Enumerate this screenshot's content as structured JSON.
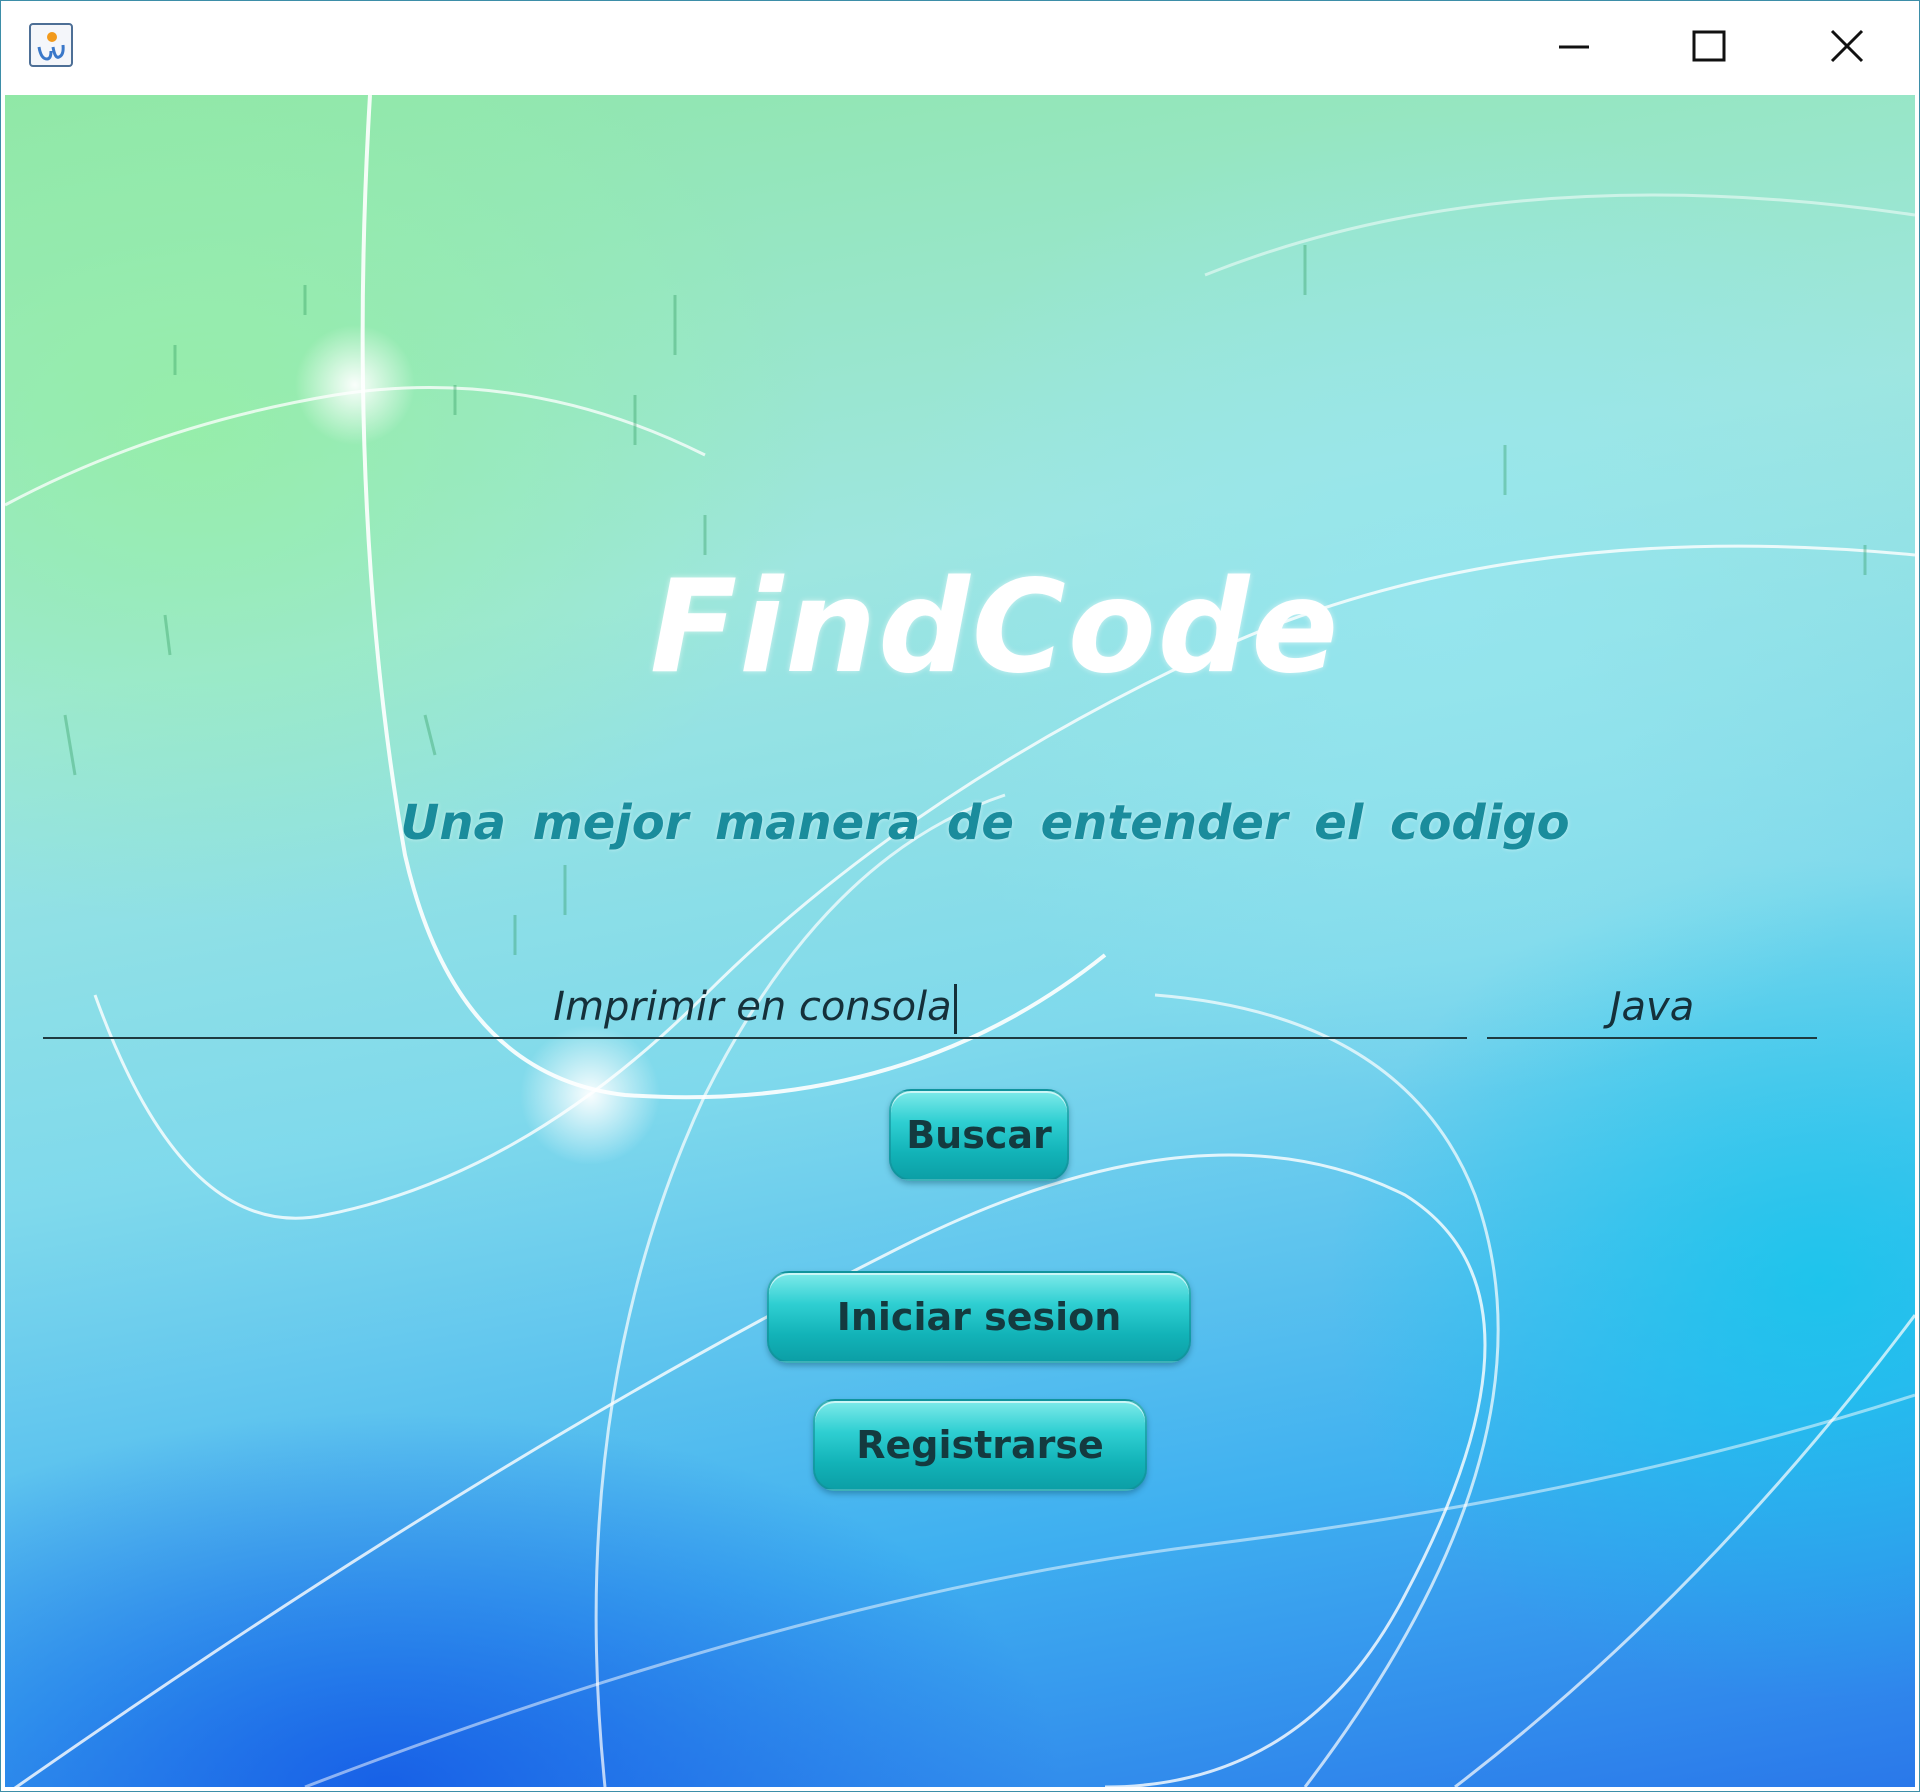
{
  "window": {
    "controls": {
      "minimize_icon": "minimize-icon",
      "maximize_icon": "maximize-icon",
      "close_icon": "close-icon"
    }
  },
  "main": {
    "title": "FindCode",
    "subtitle": "Una mejor manera de entender el codigo",
    "search": {
      "value": "Imprimir en consola"
    },
    "language": {
      "value": "Java"
    },
    "buttons": {
      "search_label": "Buscar",
      "login_label": "Iniciar sesion",
      "register_label": "Registrarse"
    }
  },
  "colors": {
    "title": "#ffffff",
    "subtitle": "#1a8c9c",
    "button_fill": "#12b3b8",
    "input_text": "#15303a"
  }
}
